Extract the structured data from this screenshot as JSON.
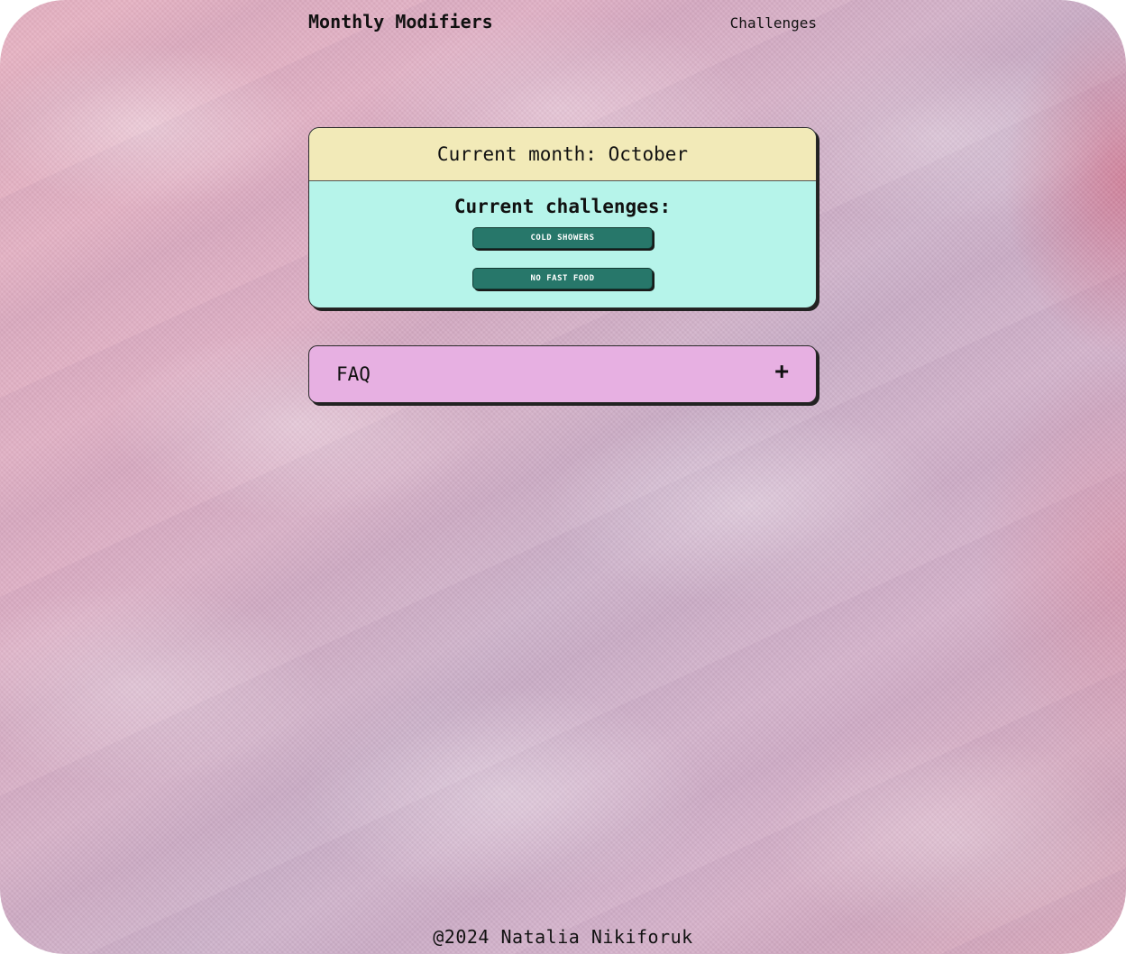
{
  "header": {
    "brand": "Monthly Modifiers",
    "nav_link": "Challenges"
  },
  "month_card": {
    "heading": "Current month: October",
    "challenges_title": "Current challenges:",
    "challenges": [
      {
        "label": "COLD SHOWERS"
      },
      {
        "label": "NO FAST FOOD"
      }
    ]
  },
  "faq": {
    "label": "FAQ",
    "toggle_icon": "plus-icon",
    "toggle_glyph": "+"
  },
  "footer": {
    "text": "@2024 Natalia Nikiforuk"
  },
  "colors": {
    "month_header_bg": "#f2eab8",
    "challenges_bg": "#b6f4ea",
    "challenge_button_bg": "#27776a",
    "faq_bg": "#e7b0e2"
  }
}
